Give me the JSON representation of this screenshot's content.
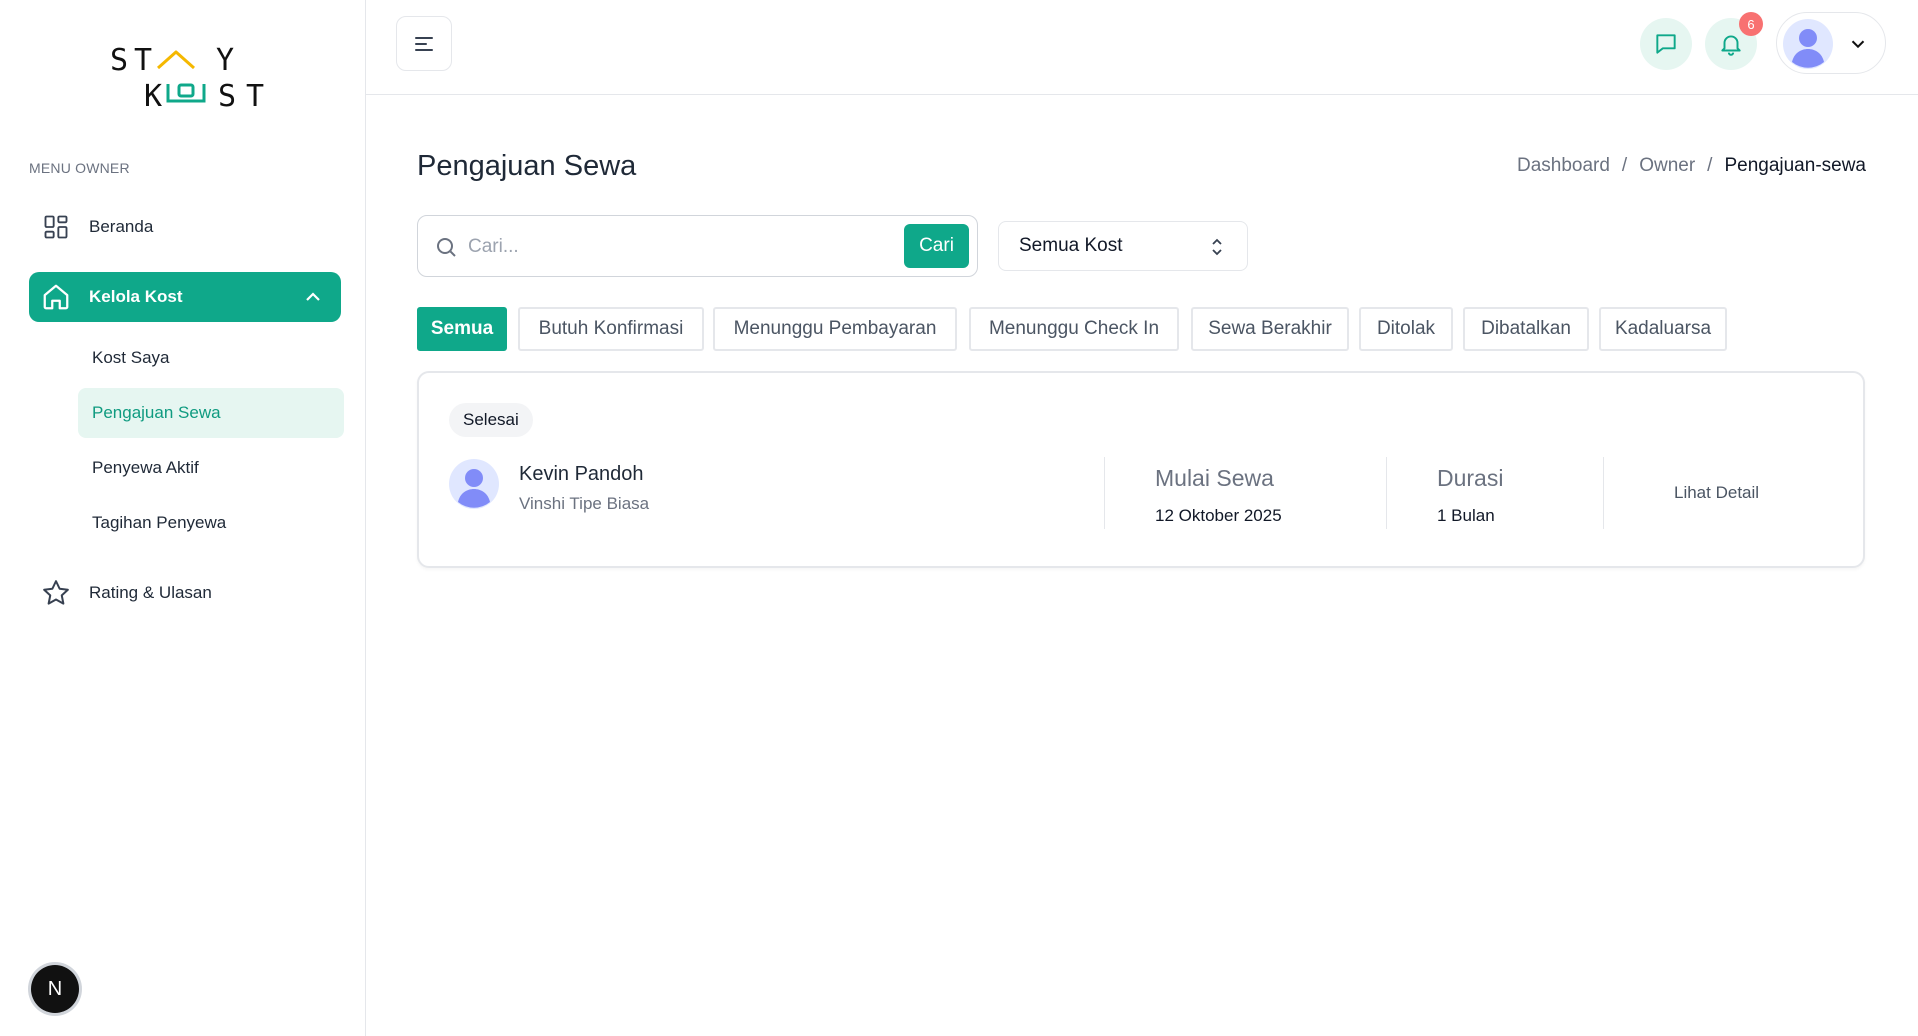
{
  "brand": {
    "logo_text_top": "ST  Y",
    "logo_text_bottom": "K  ST",
    "accent_color": "#0fa88a",
    "roof_color": "#f5b800"
  },
  "sidebar": {
    "heading": "MENU OWNER",
    "items": [
      {
        "label": "Beranda",
        "icon": "dashboard-grid-icon"
      },
      {
        "label": "Kelola Kost",
        "icon": "home-icon",
        "active": true,
        "expanded": true
      },
      {
        "label": "Rating & Ulasan",
        "icon": "star-icon"
      }
    ],
    "subitems": [
      {
        "label": "Kost Saya"
      },
      {
        "label": "Pengajuan Sewa",
        "active": true
      },
      {
        "label": "Penyewa Aktif"
      },
      {
        "label": "Tagihan Penyewa"
      }
    ],
    "dev_badge": "N"
  },
  "topbar": {
    "notification_count": "6"
  },
  "page": {
    "title": "Pengajuan Sewa",
    "breadcrumb": [
      "Dashboard",
      "Owner",
      "Pengajuan-sewa"
    ],
    "search": {
      "placeholder": "Cari...",
      "button": "Cari"
    },
    "kost_filter": {
      "selected": "Semua Kost"
    },
    "tabs": [
      {
        "label": "Semua",
        "active": true
      },
      {
        "label": "Butuh Konfirmasi"
      },
      {
        "label": "Menunggu Pembayaran"
      },
      {
        "label": "Menunggu Check In"
      },
      {
        "label": "Sewa Berakhir"
      },
      {
        "label": "Ditolak"
      },
      {
        "label": "Dibatalkan"
      },
      {
        "label": "Kadaluarsa"
      }
    ]
  },
  "requests": [
    {
      "status": "Selesai",
      "tenant_name": "Kevin Pandoh",
      "room": "Vinshi Tipe Biasa",
      "start_label": "Mulai Sewa",
      "start_date": "12 Oktober 2025",
      "duration_label": "Durasi",
      "duration": "1 Bulan",
      "detail_link": "Lihat Detail"
    }
  ]
}
